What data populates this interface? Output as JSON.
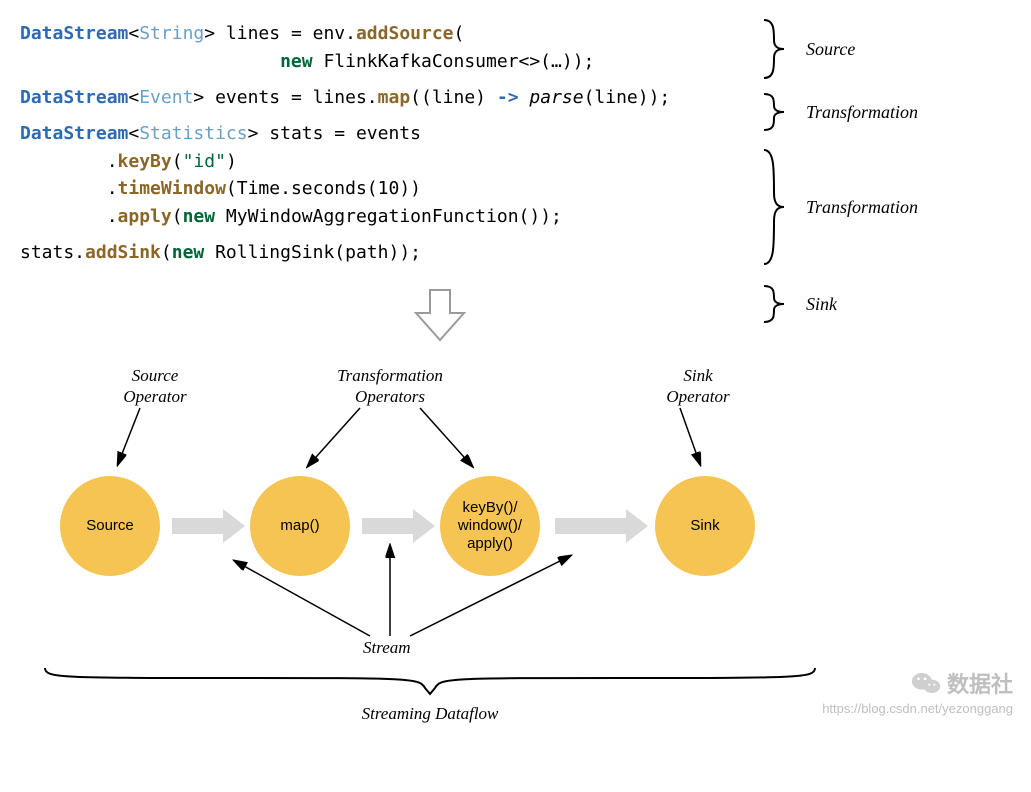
{
  "code": {
    "line1": {
      "type": "DataStream",
      "generic": "String",
      "after_generic": "> lines = env.",
      "method": "addSource",
      "tail": "("
    },
    "line2": {
      "pad": "                        ",
      "new": "new",
      "text": " FlinkKafkaConsumer<>(…));"
    },
    "line3": {
      "type": "DataStream",
      "generic": "Event",
      "after_generic": "> events = lines.",
      "method": "map",
      "open": "((line) ",
      "arrow": "->",
      "space": " ",
      "call": "parse",
      "tail": "(line));"
    },
    "line4": {
      "type": "DataStream",
      "generic": "Statistics",
      "after_generic": "> stats = events"
    },
    "line5": {
      "pad": "        .",
      "method": "keyBy",
      "open": "(",
      "str": "\"id\"",
      "tail": ")"
    },
    "line6": {
      "pad": "        .",
      "method": "timeWindow",
      "tail": "(Time.seconds(10))"
    },
    "line7": {
      "pad": "        .",
      "method": "apply",
      "open": "(",
      "new": "new",
      "tail": " MyWindowAggregationFunction());"
    },
    "line8": {
      "pre": "stats.",
      "method": "addSink",
      "open": "(",
      "new": "new",
      "tail": " RollingSink(path));"
    }
  },
  "braces": {
    "b1": "Source",
    "b2": "Transformation",
    "b3": "Transformation",
    "b4": "Sink"
  },
  "diagram": {
    "source_operator": "Source\nOperator",
    "transformation_operators": "Transformation\nOperators",
    "sink_operator": "Sink\nOperator",
    "node_source": "Source",
    "node_map": "map()",
    "node_keyby": "keyBy()/\nwindow()/\napply()",
    "node_sink": "Sink",
    "stream": "Stream",
    "streaming_dataflow": "Streaming Dataflow"
  },
  "watermark": {
    "brand": "数据社",
    "url": "https://blog.csdn.net/yezonggang"
  }
}
